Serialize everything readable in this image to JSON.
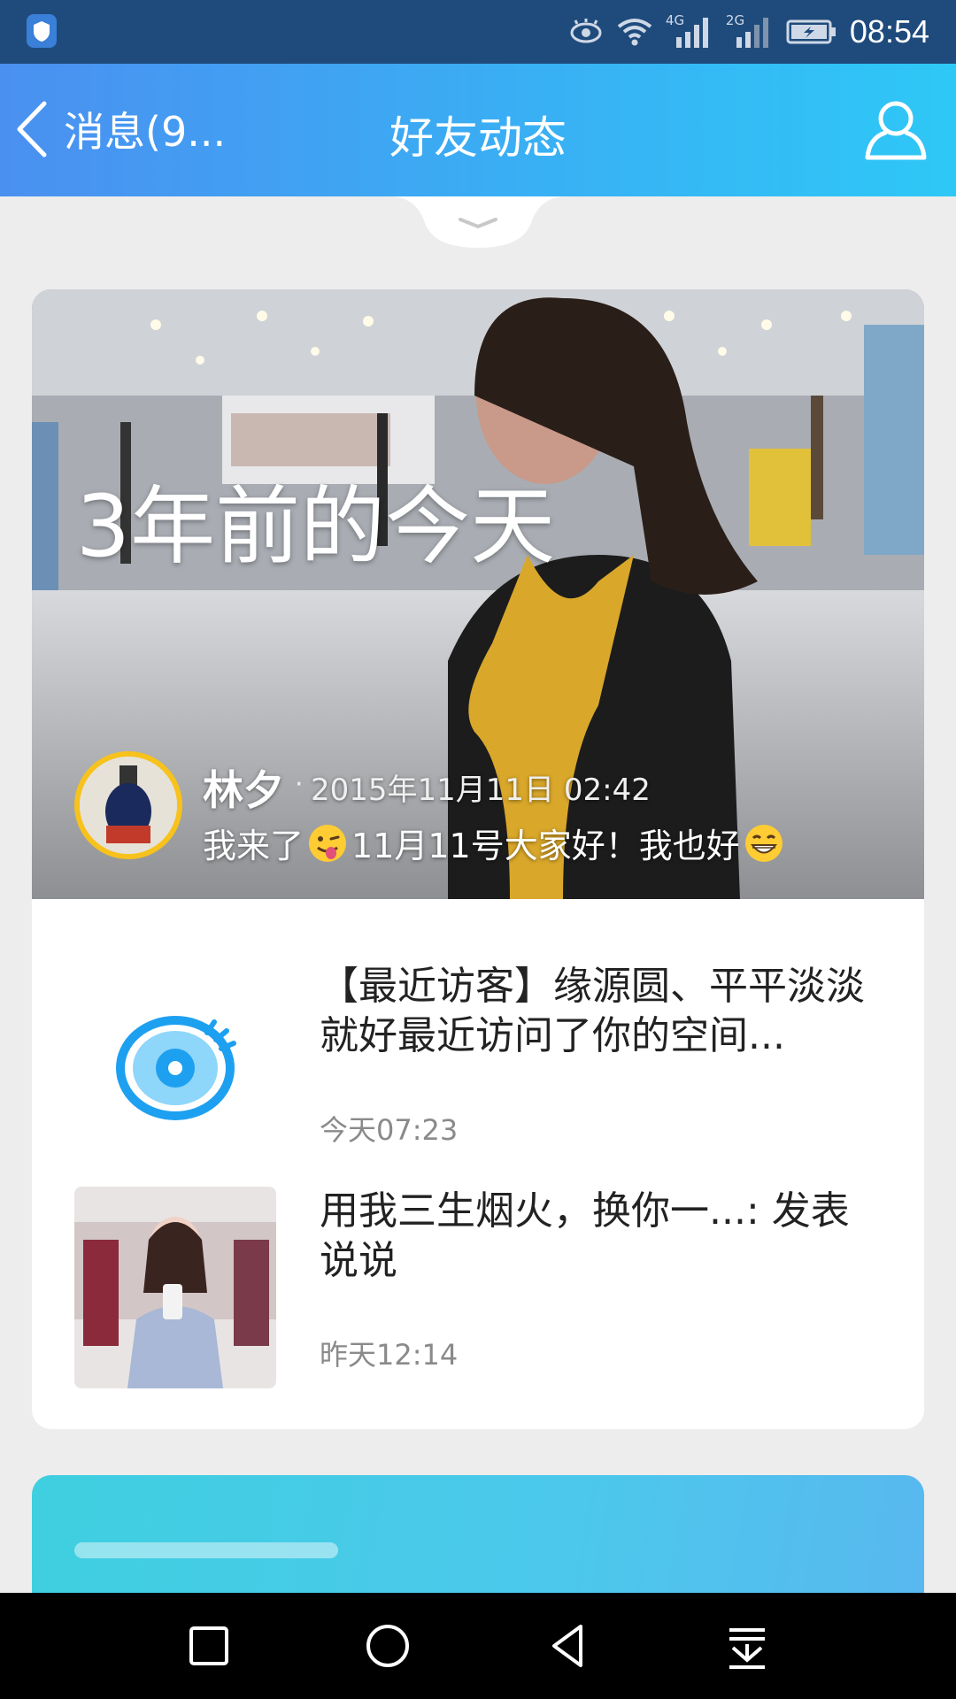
{
  "status_bar": {
    "time": "08:54",
    "network_1": "4G",
    "network_2": "2G",
    "icons": [
      "shield-icon",
      "eye-icon",
      "wifi-icon",
      "signal-icon",
      "battery-icon"
    ]
  },
  "header": {
    "back_label": "消息(9...",
    "title": "好友动态",
    "accent_start": "#4a90f0",
    "accent_end": "#2ec8f6"
  },
  "memory": {
    "title": "3年前的今天",
    "author": "林夕",
    "separator": "·",
    "date": "2015年11月11日 02:42",
    "text_part1": "我来了",
    "text_part2": "11月11号大家好！我也好"
  },
  "feed": [
    {
      "title": "【最近访客】缘源圆、平平淡淡就好最近访问了你的空间...",
      "time": "今天07:23",
      "icon": "eye-icon"
    },
    {
      "title": "用我三生烟火，换你一...: 发表说说",
      "time": "昨天12:14",
      "icon": "photo-thumbnail"
    }
  ],
  "nav": [
    "square-icon",
    "circle-icon",
    "back-triangle-icon",
    "notification-down-icon"
  ]
}
